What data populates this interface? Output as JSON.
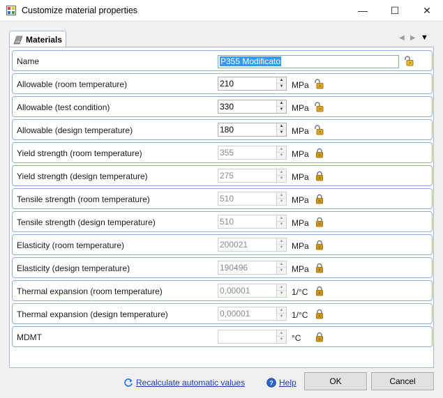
{
  "window": {
    "title": "Customize material properties",
    "minimize_glyph": "—",
    "maximize_glyph": "☐",
    "close_glyph": "✕"
  },
  "tab": {
    "label": "Materials",
    "nav_left": "◀",
    "nav_right": "▶",
    "nav_menu": "▼"
  },
  "name_row": {
    "label": "Name",
    "value": "P355 Modificato"
  },
  "properties": [
    {
      "label": "Allowable (room temperature)",
      "value": "210",
      "unit": "MPa",
      "enabled": true
    },
    {
      "label": "Allowable (test condition)",
      "value": "330",
      "unit": "MPa",
      "enabled": true
    },
    {
      "label": "Allowable (design temperature)",
      "value": "180",
      "unit": "MPa",
      "enabled": true
    },
    {
      "label": "Yield strength (room temperature)",
      "value": "355",
      "unit": "MPa",
      "enabled": false
    },
    {
      "label": "Yield strength (design temperature)",
      "value": "275",
      "unit": "MPa",
      "enabled": false
    },
    {
      "label": "Tensile strength (room temperature)",
      "value": "510",
      "unit": "MPa",
      "enabled": false
    },
    {
      "label": "Tensile strength (design temperature)",
      "value": "510",
      "unit": "MPa",
      "enabled": false
    },
    {
      "label": "Elasticity (room temperature)",
      "value": "200021",
      "unit": "MPa",
      "enabled": false
    },
    {
      "label": "Elasticity (design temperature)",
      "value": "190496",
      "unit": "MPa",
      "enabled": false
    },
    {
      "label": "Thermal expansion (room temperature)",
      "value": "0,00001",
      "unit": "1/°C",
      "enabled": false
    },
    {
      "label": "Thermal expansion (design temperature)",
      "value": "0,00001",
      "unit": "1/°C",
      "enabled": false
    },
    {
      "label": "MDMT",
      "value": "",
      "unit": "°C",
      "enabled": false
    }
  ],
  "footer": {
    "recalc_label": "Recalculate automatic values",
    "help_label": "Help",
    "ok_label": "OK",
    "cancel_label": "Cancel"
  },
  "colors": {
    "lock_unlocked": "#d9a52b",
    "lock_locked": "#c9951f",
    "link": "#1d3fa6",
    "row_border": "#8fb0d6"
  }
}
